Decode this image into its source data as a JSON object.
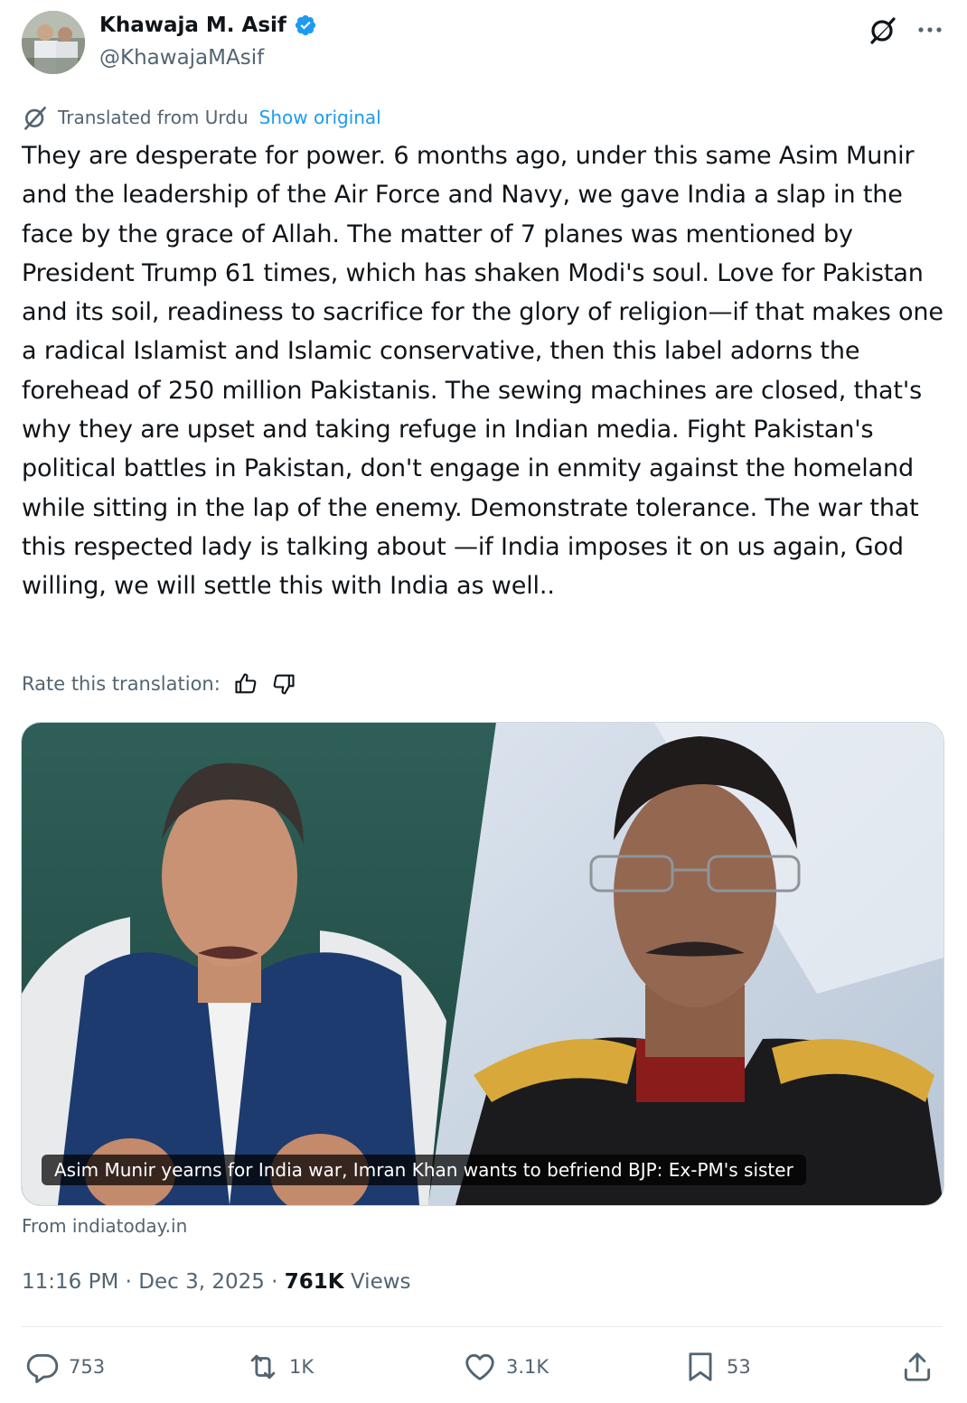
{
  "author": {
    "name": "Khawaja M. Asif",
    "handle": "@KhawajaMAsif",
    "verified_color": "#1d9bf0"
  },
  "header_icons": [
    "grok-icon",
    "more-icon"
  ],
  "translation": {
    "label": "Translated from Urdu",
    "show_original": "Show original",
    "rate_label": "Rate this translation:"
  },
  "post": {
    "text": "They are desperate for power. 6 months ago, under this same Asim Munir and the leadership of the Air Force and Navy, we gave India a slap in the face by the grace of Allah. The matter of 7 planes was mentioned by President Trump 61 times, which has shaken Modi's soul. Love for Pakistan and its soil, readiness to sacrifice for the glory of religion—if that makes one a radical Islamist and Islamic conservative, then this label adorns the forehead of 250 million Pakistanis. The sewing machines are closed, that's why they are upset and taking refuge in Indian media. Fight Pakistan's political battles in Pakistan, don't engage in enmity against the homeland while sitting in the lap of the enemy. Demonstrate tolerance. The war that this respected lady is talking about —if India imposes it on us again, God willing, we will settle this with India as well.."
  },
  "link_card": {
    "caption": "Asim Munir yearns for India war, Imran Khan wants to befriend BJP: Ex-PM's sister",
    "source": "From indiatoday.in"
  },
  "meta": {
    "time": "11:16 PM",
    "date": "Dec 3, 2025",
    "separator": "·",
    "views_count": "761K",
    "views_label": "Views"
  },
  "actions": {
    "replies": "753",
    "reposts": "1K",
    "likes": "3.1K",
    "bookmarks": "53"
  },
  "colors": {
    "accent": "#1d9bf0",
    "text": "#0f1419",
    "muted": "#536471"
  }
}
